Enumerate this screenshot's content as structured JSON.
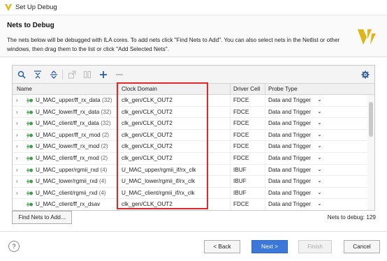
{
  "window": {
    "title": "Set Up Debug"
  },
  "header": {
    "title": "Nets to Debug",
    "description": "The nets below will be debugged with ILA cores. To add nets click \"Find Nets to Add\". You can also select nets in the Netlist or other windows, then drag them to the list or click \"Add Selected Nets\"."
  },
  "toolbar": {
    "buttons": [
      {
        "icon": "search-icon"
      },
      {
        "icon": "collapse-all-icon"
      },
      {
        "icon": "expand-all-icon"
      },
      {
        "icon": "export-icon"
      },
      {
        "icon": "compare-icon"
      },
      {
        "icon": "add-icon"
      },
      {
        "icon": "remove-icon"
      },
      {
        "icon": "gear-icon"
      }
    ]
  },
  "table": {
    "columns": [
      "Name",
      "Clock Domain",
      "Driver Cell",
      "Probe Type"
    ],
    "rows": [
      {
        "name": "U_MAC_upper/ff_rx_data",
        "count": "(32)",
        "clock": "clk_gen/CLK_OUT2",
        "driver": "FDCE",
        "probe": "Data and Trigger"
      },
      {
        "name": "U_MAC_lower/ff_rx_data",
        "count": "(32)",
        "clock": "clk_gen/CLK_OUT2",
        "driver": "FDCE",
        "probe": "Data and Trigger"
      },
      {
        "name": "U_MAC_client/ff_rx_data",
        "count": "(32)",
        "clock": "clk_gen/CLK_OUT2",
        "driver": "FDCE",
        "probe": "Data and Trigger"
      },
      {
        "name": "U_MAC_upper/ff_rx_mod",
        "count": "(2)",
        "clock": "clk_gen/CLK_OUT2",
        "driver": "FDCE",
        "probe": "Data and Trigger"
      },
      {
        "name": "U_MAC_lower/ff_rx_mod",
        "count": "(2)",
        "clock": "clk_gen/CLK_OUT2",
        "driver": "FDCE",
        "probe": "Data and Trigger"
      },
      {
        "name": "U_MAC_client/ff_rx_mod",
        "count": "(2)",
        "clock": "clk_gen/CLK_OUT2",
        "driver": "FDCE",
        "probe": "Data and Trigger"
      },
      {
        "name": "U_MAC_upper/rgmii_rxd",
        "count": "(4)",
        "clock": "U_MAC_upper/rgmii_if/rx_clk",
        "driver": "IBUF",
        "probe": "Data and Trigger"
      },
      {
        "name": "U_MAC_lower/rgmii_rxd",
        "count": "(4)",
        "clock": "U_MAC_lower/rgmii_if/rx_clk",
        "driver": "IBUF",
        "probe": "Data and Trigger"
      },
      {
        "name": "U_MAC_client/rgmii_rxd",
        "count": "(4)",
        "clock": "U_MAC_client/rgmii_if/rx_clk",
        "driver": "IBUF",
        "probe": "Data and Trigger"
      },
      {
        "name": "U_MAC_client/ff_rx_dsav",
        "count": "",
        "clock": "clk_gen/CLK_OUT2",
        "driver": "FDCE",
        "probe": "Data and Trigger"
      }
    ]
  },
  "find_nets_button": "Find Nets to Add...",
  "nets_to_debug": "Nets to debug: 129",
  "footer": {
    "help": "?",
    "back": "< Back",
    "next": "Next >",
    "finish": "Finish",
    "cancel": "Cancel"
  },
  "colors": {
    "highlight": "#e0282c",
    "primary": "#3b78d8",
    "logo": "#e0b51a"
  }
}
